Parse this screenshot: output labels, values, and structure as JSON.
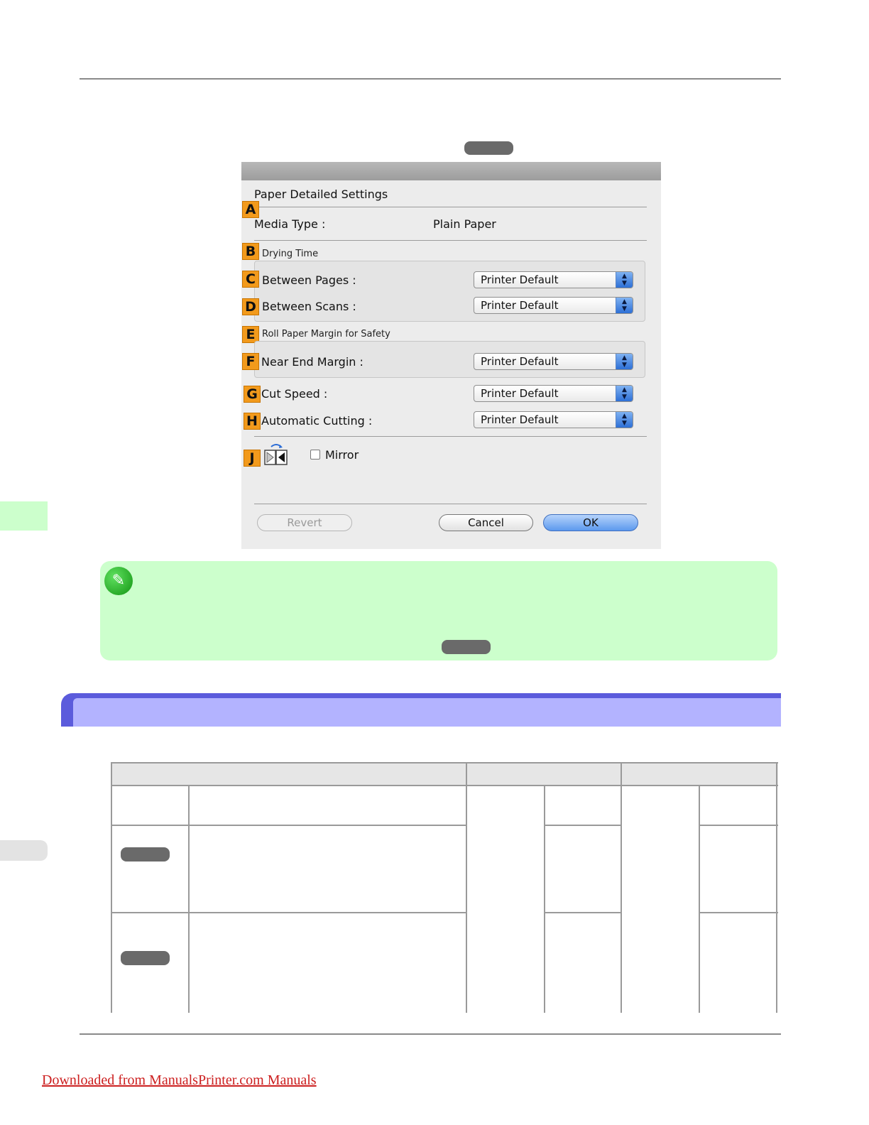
{
  "dialog": {
    "heading": "Paper Detailed Settings",
    "badges": {
      "a": "A",
      "b": "B",
      "c": "C",
      "d": "D",
      "e": "E",
      "f": "F",
      "g": "G",
      "h": "H",
      "j": "J"
    },
    "media_type_label": "Media Type :",
    "media_type_value": "Plain Paper",
    "drying_time_label": "Drying Time",
    "between_pages_label": "Between Pages :",
    "between_pages_value": "Printer Default",
    "between_scans_label": "Between Scans :",
    "between_scans_value": "Printer Default",
    "roll_margin_label": "Roll Paper Margin for Safety",
    "near_end_margin_label": "Near End Margin :",
    "near_end_margin_value": "Printer Default",
    "cut_speed_label": "Cut Speed :",
    "cut_speed_value": "Printer Default",
    "auto_cutting_label": "Automatic Cutting :",
    "auto_cutting_value": "Printer Default",
    "mirror_label": "Mirror",
    "mirror_checked": false,
    "revert_label": "Revert",
    "cancel_label": "Cancel",
    "ok_label": "OK"
  },
  "icons": {
    "mirror": "mirror-flip-icon",
    "note": "pencil-note-icon",
    "select_arrow": "up-down-arrows-icon"
  },
  "colors": {
    "badge": "#f29a1c",
    "note_background": "#ccffcc",
    "section_header": "#b3b3ff",
    "section_header_border": "#5b5bdc",
    "ok_button": "#5c99ee",
    "footer_link": "#cc1f1f"
  },
  "footer": {
    "link_text": "Downloaded from ManualsPrinter.com Manuals"
  }
}
